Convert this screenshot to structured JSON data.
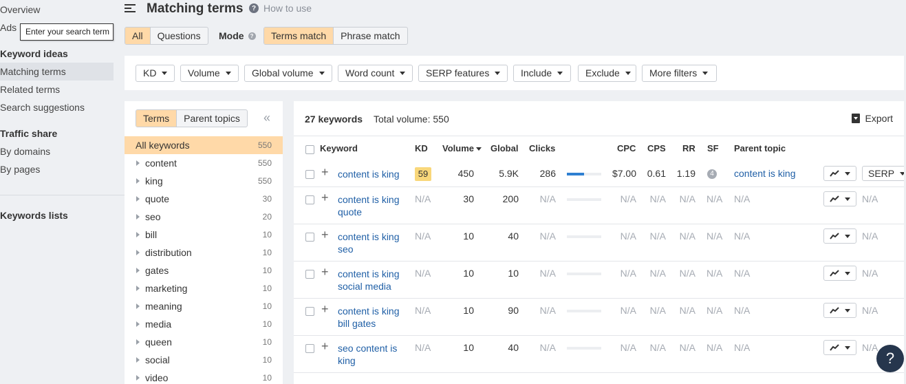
{
  "sidebar": {
    "overview": "Overview",
    "ads_history": "Ads h",
    "tooltip": "Enter your search term",
    "keyword_ideas_head": "Keyword ideas",
    "matching_terms": "Matching terms",
    "related_terms": "Related terms",
    "search_suggestions": "Search suggestions",
    "traffic_share_head": "Traffic share",
    "by_domains": "By domains",
    "by_pages": "By pages",
    "keywords_lists": "Keywords lists"
  },
  "header": {
    "title": "Matching terms",
    "how_to_use": "How to use"
  },
  "scope": {
    "all": "All",
    "questions": "Questions",
    "mode_label": "Mode",
    "terms_match": "Terms match",
    "phrase_match": "Phrase match"
  },
  "filters": [
    "KD",
    "Volume",
    "Global volume",
    "Word count",
    "SERP features",
    "Include",
    "Exclude",
    "More filters"
  ],
  "terms_panel": {
    "terms_tab": "Terms",
    "parent_topics_tab": "Parent topics",
    "collapse": "«",
    "all_keywords": {
      "label": "All keywords",
      "count": "550"
    },
    "items": [
      {
        "label": "content",
        "count": "550"
      },
      {
        "label": "king",
        "count": "550"
      },
      {
        "label": "quote",
        "count": "30"
      },
      {
        "label": "seo",
        "count": "20"
      },
      {
        "label": "bill",
        "count": "10"
      },
      {
        "label": "distribution",
        "count": "10"
      },
      {
        "label": "gates",
        "count": "10"
      },
      {
        "label": "marketing",
        "count": "10"
      },
      {
        "label": "meaning",
        "count": "10"
      },
      {
        "label": "media",
        "count": "10"
      },
      {
        "label": "queen",
        "count": "10"
      },
      {
        "label": "social",
        "count": "10"
      },
      {
        "label": "video",
        "count": "10"
      }
    ]
  },
  "results": {
    "keywords_count": "27 keywords",
    "total_volume": "Total volume: 550",
    "export": "Export",
    "columns": {
      "keyword": "Keyword",
      "kd": "KD",
      "volume": "Volume",
      "global": "Global",
      "clicks": "Clicks",
      "cpc": "CPC",
      "cps": "CPS",
      "rr": "RR",
      "sf": "SF",
      "parent_topic": "Parent topic"
    },
    "rows": [
      {
        "keyword": "content is king",
        "kd": "59",
        "volume": "450",
        "global": "5.9K",
        "clicks": "286",
        "clicks_share": 0.5,
        "cpc": "$7.00",
        "cps": "0.61",
        "rr": "1.19",
        "sf": "4",
        "parent_topic": "content is king",
        "serp": "SERP"
      },
      {
        "keyword": "content is king quote",
        "kd": "N/A",
        "volume": "30",
        "global": "200",
        "clicks": "N/A",
        "clicks_share": 0,
        "cpc": "N/A",
        "cps": "N/A",
        "rr": "N/A",
        "sf": "N/A",
        "parent_topic": "N/A",
        "serp": "N/A"
      },
      {
        "keyword": "content is king seo",
        "kd": "N/A",
        "volume": "10",
        "global": "40",
        "clicks": "N/A",
        "clicks_share": 0,
        "cpc": "N/A",
        "cps": "N/A",
        "rr": "N/A",
        "sf": "N/A",
        "parent_topic": "N/A",
        "serp": "N/A"
      },
      {
        "keyword": "content is king social media",
        "kd": "N/A",
        "volume": "10",
        "global": "10",
        "clicks": "N/A",
        "clicks_share": 0,
        "cpc": "N/A",
        "cps": "N/A",
        "rr": "N/A",
        "sf": "N/A",
        "parent_topic": "N/A",
        "serp": "N/A"
      },
      {
        "keyword": "content is king bill gates",
        "kd": "N/A",
        "volume": "10",
        "global": "90",
        "clicks": "N/A",
        "clicks_share": 0,
        "cpc": "N/A",
        "cps": "N/A",
        "rr": "N/A",
        "sf": "N/A",
        "parent_topic": "N/A",
        "serp": "N/A"
      },
      {
        "keyword": "seo content is king",
        "kd": "N/A",
        "volume": "10",
        "global": "40",
        "clicks": "N/A",
        "clicks_share": 0,
        "cpc": "N/A",
        "cps": "N/A",
        "rr": "N/A",
        "sf": "N/A",
        "parent_topic": "N/A",
        "serp": "N/A"
      }
    ]
  },
  "help_button": "?",
  "colors": {
    "accent": "#ffd9a8",
    "link": "#1f5fa6",
    "kd_badge": "#f9d77a",
    "clicks_bar": "#2f7fd1"
  }
}
